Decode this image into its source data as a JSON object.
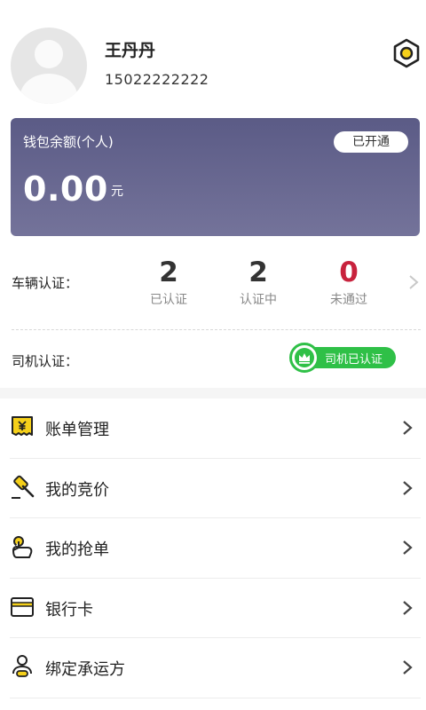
{
  "profile": {
    "name": "王丹丹",
    "phone": "15022222222",
    "avatar_icon": "default-user-avatar-icon",
    "settings_icon": "hexagon-settings-icon"
  },
  "wallet": {
    "title": "钱包余额(个人)",
    "status": "已开通",
    "amount": "0.00",
    "unit": "元"
  },
  "vehicle_cert": {
    "label": "车辆认证：",
    "stats": [
      {
        "value": "2",
        "label": "已认证"
      },
      {
        "value": "2",
        "label": "认证中"
      },
      {
        "value": "0",
        "label": "未通过"
      }
    ]
  },
  "driver_cert": {
    "label": "司机认证：",
    "status": "司机已认证",
    "badge_icon": "crown-icon"
  },
  "menu": [
    {
      "label": "账单管理",
      "icon": "bill-icon"
    },
    {
      "label": "我的竞价",
      "icon": "auction-hammer-icon"
    },
    {
      "label": "我的抢单",
      "icon": "grab-hand-icon"
    },
    {
      "label": "银行卡",
      "icon": "bank-card-icon"
    },
    {
      "label": "绑定承运方",
      "icon": "bind-carrier-icon"
    }
  ],
  "colors": {
    "accent_yellow": "#f5d01a",
    "wallet_bg": "#676690",
    "success_green": "#2fc047",
    "danger_red": "#c8223d"
  }
}
